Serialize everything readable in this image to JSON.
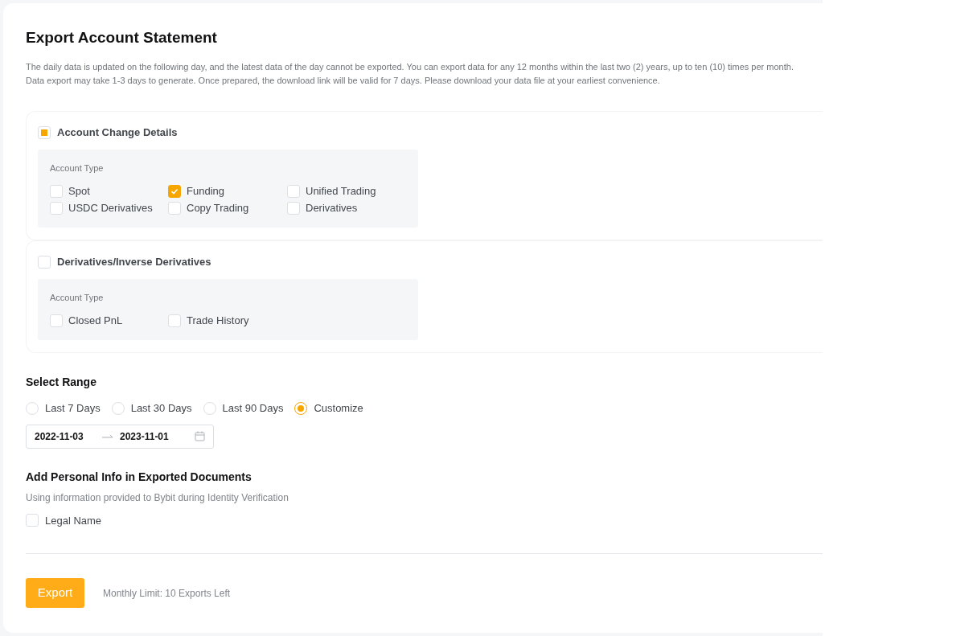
{
  "title": "Export Account Statement",
  "description": [
    "The daily data is updated on the following day, and the latest data of the day cannot be exported. You can export data for any 12 months within the last two (2) years, up to ten (10) times per month.",
    "Data export may take 1-3 days to generate. Once prepared, the download link will be valid for 7 days. Please download your data file at your earliest convenience."
  ],
  "sections": [
    {
      "label": "Account Change Details",
      "checked": false,
      "indeterminate": true,
      "group_label": "Account Type",
      "options": [
        {
          "label": "Spot",
          "checked": false
        },
        {
          "label": "Funding",
          "checked": true
        },
        {
          "label": "Unified Trading",
          "checked": false
        },
        {
          "label": "USDC Derivatives",
          "checked": false
        },
        {
          "label": "Copy Trading",
          "checked": false
        },
        {
          "label": "Derivatives",
          "checked": false
        }
      ]
    },
    {
      "label": "Derivatives/Inverse Derivatives",
      "checked": false,
      "indeterminate": false,
      "group_label": "Account Type",
      "options": [
        {
          "label": "Closed PnL",
          "checked": false
        },
        {
          "label": "Trade History",
          "checked": false
        }
      ]
    }
  ],
  "range": {
    "title": "Select Range",
    "options": [
      {
        "label": "Last 7 Days",
        "selected": false
      },
      {
        "label": "Last 30 Days",
        "selected": false
      },
      {
        "label": "Last 90 Days",
        "selected": false
      },
      {
        "label": "Customize",
        "selected": true
      }
    ],
    "start": "2022-11-03",
    "end": "2023-11-01"
  },
  "personal": {
    "title": "Add Personal Info in Exported Documents",
    "subtitle": "Using information provided to Bybit during Identity Verification",
    "options": [
      {
        "label": "Legal Name",
        "checked": false
      }
    ]
  },
  "export_button": "Export",
  "limit": "Monthly Limit: 10 Exports Left"
}
